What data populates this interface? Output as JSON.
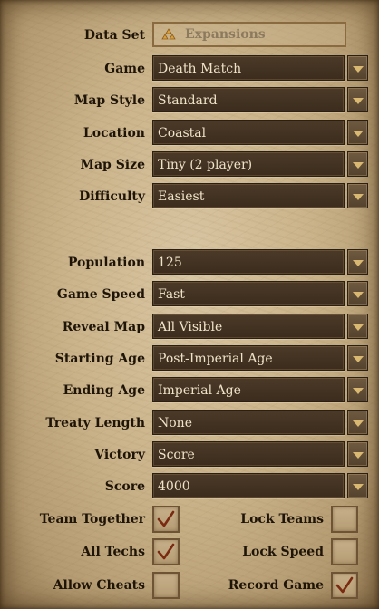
{
  "data_set": {
    "label": "Data Set",
    "value": "Expansions",
    "icon": "expansions-icon"
  },
  "settings_top": [
    {
      "key": "game",
      "label": "Game",
      "value": "Death Match"
    },
    {
      "key": "map-style",
      "label": "Map Style",
      "value": "Standard"
    },
    {
      "key": "location",
      "label": "Location",
      "value": "Coastal"
    },
    {
      "key": "map-size",
      "label": "Map Size",
      "value": "Tiny (2 player)"
    },
    {
      "key": "difficulty",
      "label": "Difficulty",
      "value": "Easiest"
    }
  ],
  "settings_bottom": [
    {
      "key": "population",
      "label": "Population",
      "value": "125"
    },
    {
      "key": "game-speed",
      "label": "Game Speed",
      "value": "Fast"
    },
    {
      "key": "reveal-map",
      "label": "Reveal Map",
      "value": "All Visible"
    },
    {
      "key": "starting-age",
      "label": "Starting Age",
      "value": "Post-Imperial Age"
    },
    {
      "key": "ending-age",
      "label": "Ending Age",
      "value": "Imperial Age"
    },
    {
      "key": "treaty-length",
      "label": "Treaty Length",
      "value": "None"
    },
    {
      "key": "victory",
      "label": "Victory",
      "value": "Score"
    },
    {
      "key": "score",
      "label": "Score",
      "value": "4000"
    }
  ],
  "checkboxes": [
    {
      "key": "team-together",
      "label": "Team Together",
      "checked": true
    },
    {
      "key": "lock-teams",
      "label": "Lock Teams",
      "checked": false
    },
    {
      "key": "all-techs",
      "label": "All Techs",
      "checked": true
    },
    {
      "key": "lock-speed",
      "label": "Lock Speed",
      "checked": false
    },
    {
      "key": "allow-cheats",
      "label": "Allow Cheats",
      "checked": false
    },
    {
      "key": "record-game",
      "label": "Record Game",
      "checked": true
    }
  ],
  "colors": {
    "field_bg": "#3f2f20",
    "field_text": "#efe3c8",
    "label_text": "#1e1408",
    "check": "#7a2a10",
    "accent": "#d9b871"
  }
}
